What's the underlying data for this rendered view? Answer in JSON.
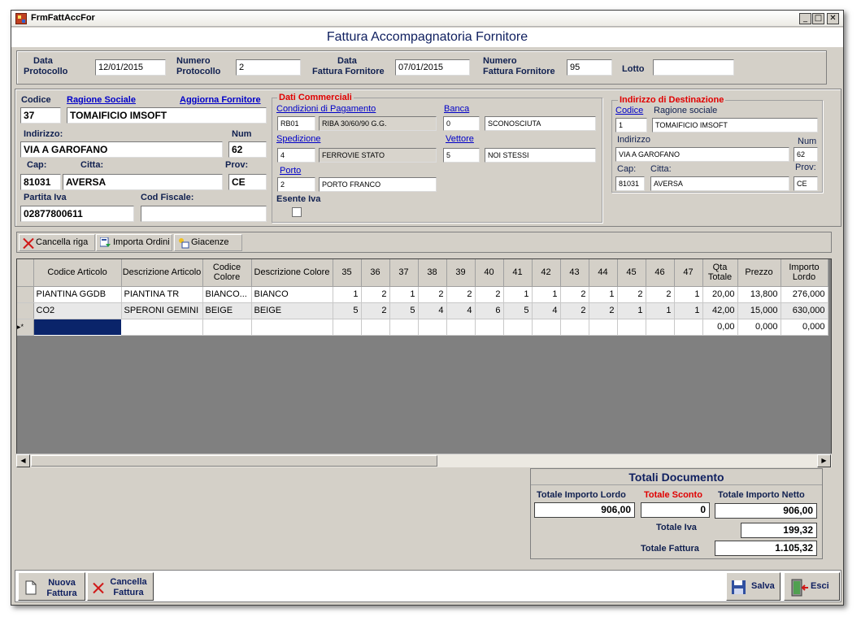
{
  "window": {
    "title": "FrmFattAccFor",
    "controls": [
      "_",
      "□",
      "✕"
    ]
  },
  "header": {
    "title": "Fattura Accompagnatoria Fornitore"
  },
  "protocol": {
    "data_protocollo_label1": "Data",
    "data_protocollo_label2": "Protocollo",
    "data_protocollo": "12/01/2015",
    "numero_protocollo_label1": "Numero",
    "numero_protocollo_label2": "Protocollo",
    "numero_protocollo": "2",
    "data_fattura_label1": "Data",
    "data_fattura_label2": "Fattura Fornitore",
    "data_fattura": "07/01/2015",
    "numero_fattura_label1": "Numero",
    "numero_fattura_label2": "Fattura Fornitore",
    "numero_fattura": "95",
    "lotto_label": "Lotto",
    "lotto": ""
  },
  "fornitore": {
    "codice_label": "Codice",
    "codice": "37",
    "ragione_label": "Ragione Sociale",
    "ragione": "TOMAIFICIO IMSOFT",
    "aggiorna_label": "Aggiorna Fornitore",
    "indirizzo_label": "Indirizzo:",
    "indirizzo": "VIA A GAROFANO",
    "num_label": "Num",
    "num": "62",
    "cap_label": "Cap:",
    "cap": "81031",
    "citta_label": "Citta:",
    "citta": "AVERSA",
    "prov_label": "Prov:",
    "prov": "CE",
    "piva_label": "Partita Iva",
    "piva": "02877800611",
    "codfisc_label": "Cod Fiscale:",
    "codfisc": ""
  },
  "commerciali": {
    "title": "Dati Commerciali",
    "cond_label": "Condizioni di Pagamento",
    "cond_code": "RB01",
    "cond_desc": "RIBA 30/60/90 G.G.",
    "banca_label": "Banca",
    "banca_code": "0",
    "banca_desc": "SCONOSCIUTA",
    "sped_label": "Spedizione",
    "sped_code": "4",
    "sped_desc": "FERROVIE STATO",
    "vettore_label": "Vettore",
    "vettore_code": "5",
    "vettore_desc": "NOI STESSI",
    "porto_label": "Porto",
    "porto_code": "2",
    "porto_desc": "PORTO FRANCO",
    "esente_label": "Esente Iva"
  },
  "destinazione": {
    "title": "Indirizzo di Destinazione",
    "codice_label": "Codice",
    "codice": "1",
    "ragione_label": "Ragione sociale",
    "ragione": "TOMAIFICIO IMSOFT",
    "indirizzo_label": "Indirizzo",
    "indirizzo": "VIA A GAROFANO",
    "num_label": "Num",
    "num": "62",
    "cap_label": "Cap:",
    "cap": "81031",
    "citta_label": "Citta:",
    "citta": "AVERSA",
    "prov_label": "Prov:",
    "prov": "CE"
  },
  "toolbar": {
    "cancella": "Cancella riga",
    "importa": "Importa Ordini",
    "giacenze": "Giacenze"
  },
  "grid": {
    "columns": [
      "Codice Articolo",
      "Descrizione Articolo",
      "Codice Colore",
      "Descrizione Colore",
      "35",
      "36",
      "37",
      "38",
      "39",
      "40",
      "41",
      "42",
      "43",
      "44",
      "45",
      "46",
      "47",
      "Qta Totale",
      "Prezzo",
      "Importo Lordo"
    ],
    "rows": [
      [
        "PIANTINA GGDB",
        "PIANTINA TR",
        "BIANCO...",
        "BIANCO",
        "1",
        "2",
        "1",
        "2",
        "2",
        "2",
        "1",
        "1",
        "2",
        "1",
        "2",
        "2",
        "1",
        "20,00",
        "13,800",
        "276,000"
      ],
      [
        "CO2",
        "SPERONI GEMINI",
        "BEIGE",
        "BEIGE",
        "5",
        "2",
        "5",
        "4",
        "4",
        "6",
        "5",
        "4",
        "2",
        "2",
        "1",
        "1",
        "1",
        "42,00",
        "15,000",
        "630,000"
      ],
      [
        "",
        "",
        "",
        "",
        "",
        "",
        "",
        "",
        "",
        "",
        "",
        "",
        "",
        "",
        "",
        "",
        "",
        "0,00",
        "0,000",
        "0,000"
      ]
    ]
  },
  "totals": {
    "title": "Totali Documento",
    "lordo_label": "Totale Importo Lordo",
    "lordo": "906,00",
    "sconto_label": "Totale Sconto",
    "sconto": "0",
    "netto_label": "Totale Importo Netto",
    "netto": "906,00",
    "iva_label": "Totale Iva",
    "iva": "199,32",
    "fattura_label": "Totale Fattura",
    "fattura": "1.105,32"
  },
  "bottom": {
    "nuova1": "Nuova",
    "nuova2": "Fattura",
    "cancella1": "Cancella",
    "cancella2": "Fattura",
    "salva": "Salva",
    "esci": "Esci"
  }
}
